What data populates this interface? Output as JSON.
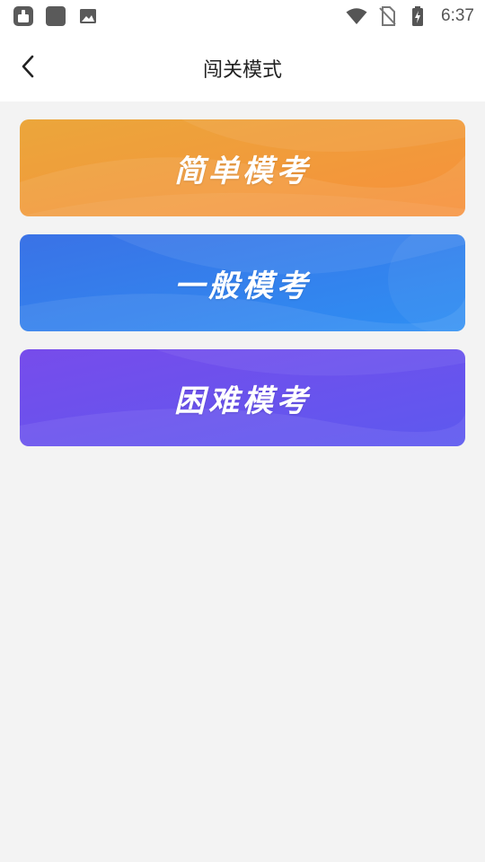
{
  "status_bar": {
    "time": "6:37",
    "icons": [
      "robot-icon",
      "square-app-icon",
      "image-icon",
      "wifi-icon",
      "no-sim-icon",
      "battery-charging-icon"
    ]
  },
  "header": {
    "title": "闯关模式",
    "back_icon": "chevron-left-icon"
  },
  "modes": [
    {
      "label": "简单模考",
      "colors": [
        "#eda33a",
        "#f6913a"
      ]
    },
    {
      "label": "一般模考",
      "colors": [
        "#3b78e8",
        "#2f8cf2"
      ]
    },
    {
      "label": "困难模考",
      "colors": [
        "#7650ec",
        "#5f58ee"
      ]
    }
  ]
}
